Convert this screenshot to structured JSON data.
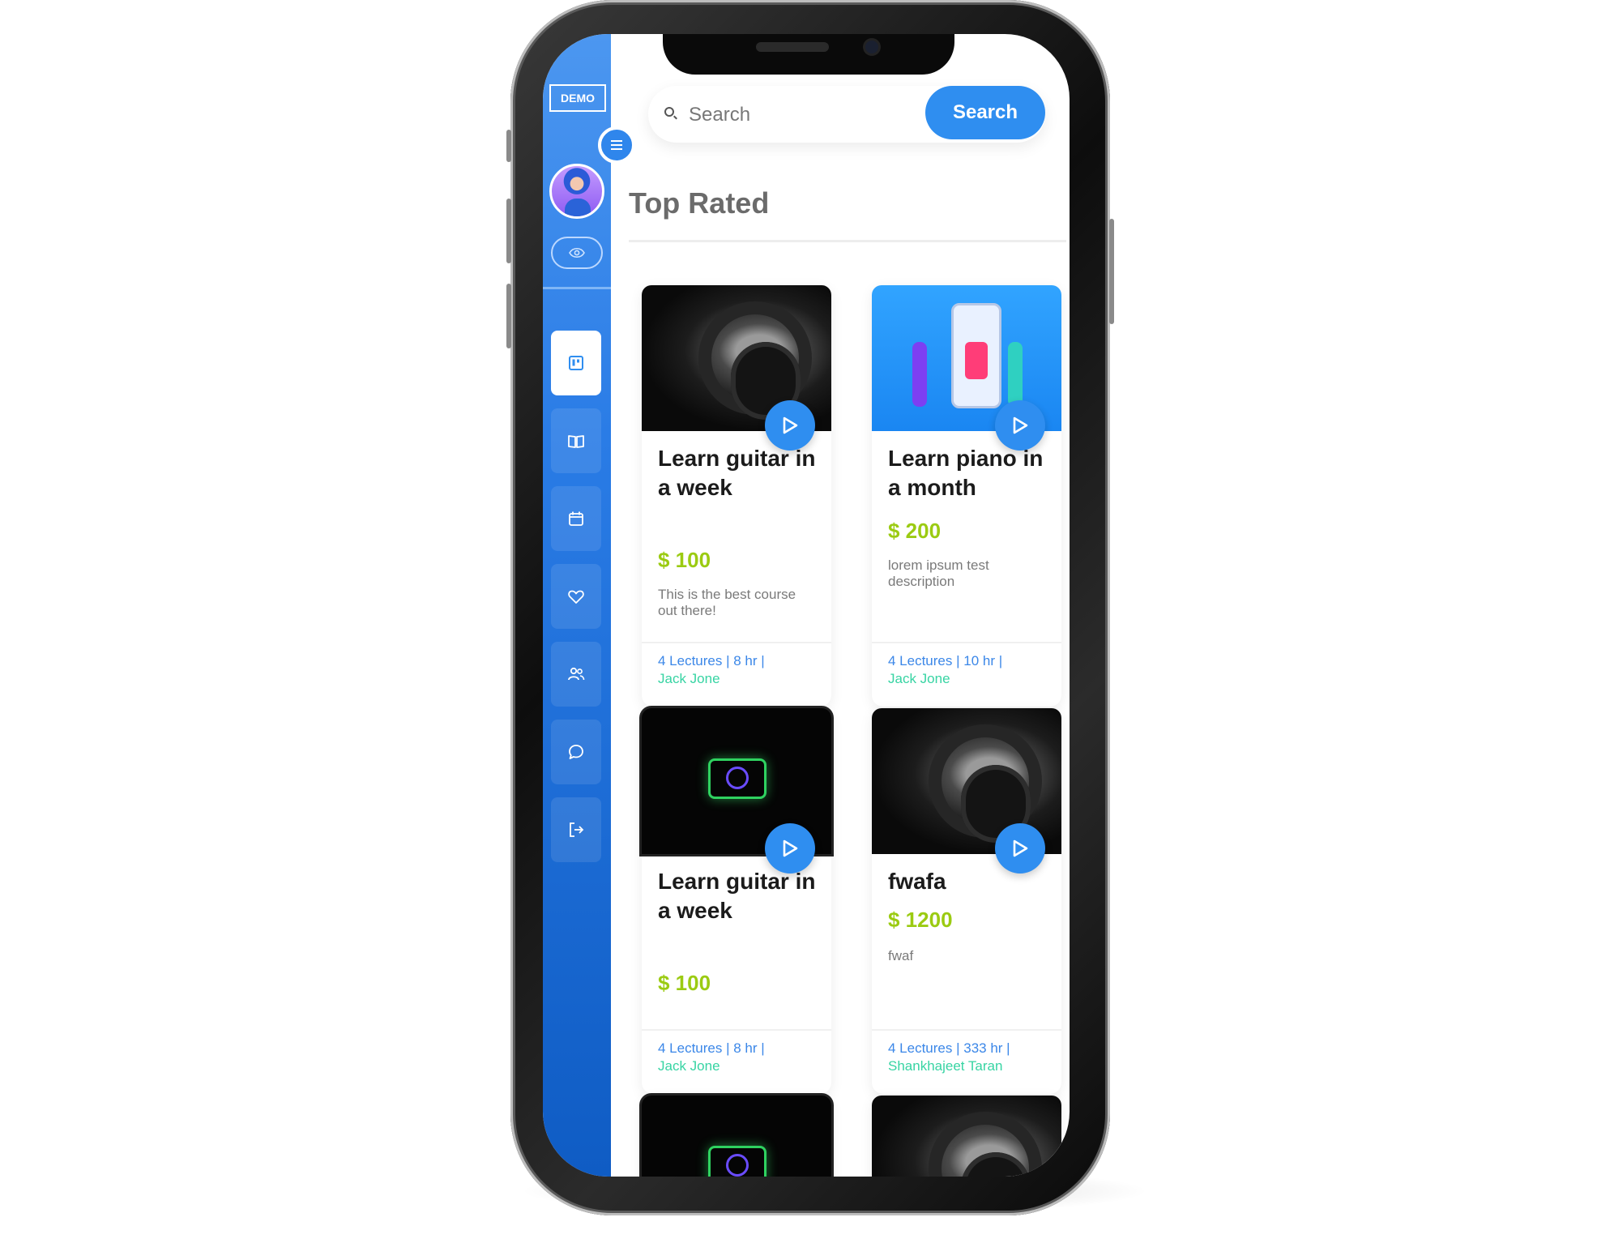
{
  "app": {
    "logo_text": "DEMO"
  },
  "search": {
    "placeholder": "Search",
    "button_label": "Search"
  },
  "section": {
    "title": "Top Rated"
  },
  "sidebar": {
    "items": [
      {
        "name": "dashboard",
        "icon": "board-icon",
        "active": true
      },
      {
        "name": "courses",
        "icon": "book-icon",
        "active": false
      },
      {
        "name": "calendar",
        "icon": "calendar-icon",
        "active": false
      },
      {
        "name": "favorites",
        "icon": "heart-icon",
        "active": false
      },
      {
        "name": "users",
        "icon": "users-icon",
        "active": false
      },
      {
        "name": "messages",
        "icon": "chat-icon",
        "active": false
      },
      {
        "name": "logout",
        "icon": "logout-icon",
        "active": false
      }
    ]
  },
  "courses": [
    {
      "title": "Learn guitar in a week",
      "price": "$ 100",
      "description": "This is the best course out there!",
      "meta": "4 Lectures | 8 hr |",
      "author": "Jack Jone",
      "thumbnail": "headphones"
    },
    {
      "title": "Learn piano in a month",
      "price": "$ 200",
      "description": "lorem ipsum test description",
      "meta": "4 Lectures | 10 hr |",
      "author": "Jack Jone",
      "thumbnail": "illustration"
    },
    {
      "title": "Learn guitar in a week",
      "price": "$ 100",
      "description": "",
      "meta": "4 Lectures | 8 hr |",
      "author": "Jack Jone",
      "thumbnail": "camera"
    },
    {
      "title": "fwafa",
      "price": "$ 1200",
      "description": "fwaf",
      "meta": "4 Lectures | 333 hr |",
      "author": "Shankhajeet Taran",
      "thumbnail": "headphones"
    }
  ],
  "colors": {
    "primary": "#2f8ef0",
    "price": "#9bcb12",
    "meta": "#3b87e8",
    "author": "#37d4a3",
    "sidebar_top": "#4c97f0",
    "sidebar_bottom": "#0f5cc4"
  }
}
